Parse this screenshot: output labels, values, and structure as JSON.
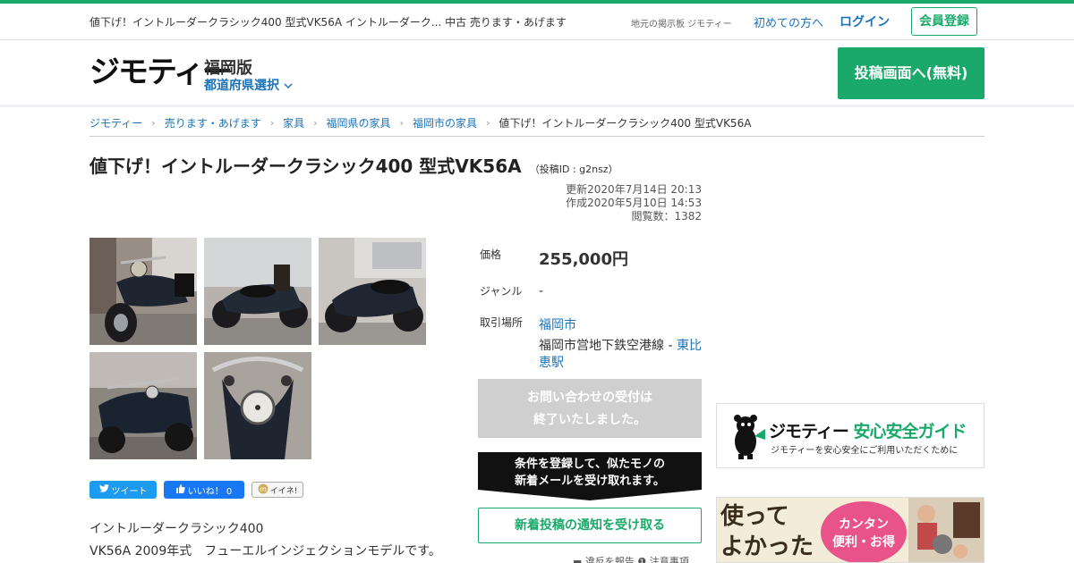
{
  "topbar": {
    "page_title": "値下げ！イントルーダークラシック400 型式VK56A イントルーダーク... 中古 売ります・あげます",
    "tagline": "地元の掲示板 ジモティー",
    "first_time": "初めての方へ",
    "login": "ログイン",
    "register": "会員登録"
  },
  "header": {
    "logo": "ジモティー",
    "edition": "福岡版",
    "pref_select": "都道府県選択",
    "post_button": "投稿画面へ(無料)"
  },
  "breadcrumb": [
    "ジモティー",
    "売ります・あげます",
    "家具",
    "福岡県の家具",
    "福岡市の家具",
    "値下げ！イントルーダークラシック400 型式VK56A"
  ],
  "listing": {
    "title": "値下げ！イントルーダークラシック400 型式VK56A",
    "post_id": "（投稿ID : g2nsz）",
    "updated": "更新2020年7月14日 20:13",
    "created": "作成2020年5月10日 14:53",
    "views": "閲覧数：1382",
    "price_label": "価格",
    "price": "255,000円",
    "genre_label": "ジャンル",
    "genre": "-",
    "place_label": "取引場所",
    "place_city": "福岡市",
    "place_line": "福岡市営地下鉄空港線 - ",
    "place_station": "東比恵駅",
    "closed_line1": "お問い合わせの受付は",
    "closed_line2": "終了いたしました。",
    "alert_line1": "条件を登録して、似たモノの",
    "alert_line2": "新着メールを受け取れます。",
    "notify_button": "新着投稿の通知を受け取る",
    "report": "違反を報告",
    "notes": "注意事項",
    "description_line1": "イントルーダークラシック400",
    "description_line2": "VK56A 2009年式　フューエルインジェクションモデルです。"
  },
  "social": {
    "tweet": "ツイート",
    "like": "いいね！ 0",
    "iine": "イイネ!"
  },
  "guide": {
    "brand": "ジモティー",
    "title": "安心安全ガイド",
    "subtitle": "ジモティーを安心安全にご利用いただくために"
  },
  "ad": {
    "line1": "使って",
    "line2": "よかった",
    "badge_line1": "カンタン",
    "badge_line2": "便利・お得"
  },
  "colors": {
    "brand_green": "#1aa96a",
    "link_blue": "#1a73b8"
  }
}
